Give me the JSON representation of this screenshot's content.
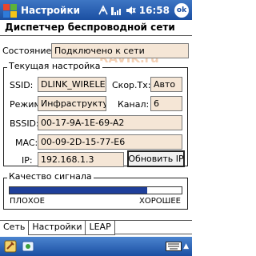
{
  "titlebar": {
    "app_title": "Настройки",
    "time": "16:58",
    "ok_label": "ok",
    "icons": [
      "windows-start-icon",
      "connectivity-icon",
      "signal-icon",
      "volume-mute-icon"
    ]
  },
  "page_title": "Диспетчер беспроводной сети",
  "status": {
    "label": "Состояние:",
    "value": "Подключено к сети"
  },
  "current_settings": {
    "caption": "Текущая настройка",
    "ssid_label": "SSID:",
    "ssid_value": "DLINK_WIRELESS",
    "speed_label": "Скор.Тх:",
    "speed_value": "Авто",
    "mode_label": "Режим:",
    "mode_value": "Инфраструктура",
    "channel_label": "Канал:",
    "channel_value": "6",
    "bssid_label": "BSSID:",
    "bssid_value": "00-17-9A-1E-69-A2",
    "mac_label": "MAC:",
    "mac_value": "00-09-2D-15-77-E6",
    "ip_label": "IP:",
    "ip_value": "192.168.1.3",
    "refresh_button": "Обновить IP"
  },
  "signal": {
    "caption": "Качество сигнала",
    "level": 0.8,
    "low_label": "ПЛОХОЕ",
    "high_label": "ХОРОШЕЕ"
  },
  "tabs": [
    "Сеть",
    "Настройки",
    "LEAP"
  ],
  "watermark": "RAVIK.ru",
  "colors": {
    "titlebar": "#1b4fa2",
    "field_bg": "#f5e6d6",
    "signal_fill": "#1f3f9a"
  }
}
